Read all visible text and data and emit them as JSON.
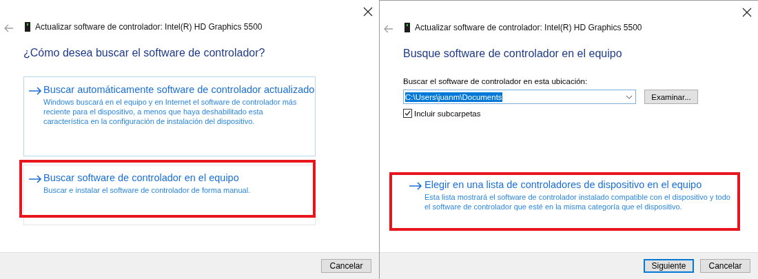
{
  "dialogs": [
    {
      "title": "Actualizar software de controlador: Intel(R) HD Graphics 5500",
      "heading": "¿Cómo desea buscar el software de controlador?",
      "options": [
        {
          "kind": "focused",
          "highlighted": false,
          "title": "Buscar automáticamente software de controlador actualizado",
          "description": "Windows buscará en el equipo y en Internet el software de controlador más reciente para el dispositivo, a menos que haya deshabilitado esta característica en la configuración de instalación del dispositivo."
        },
        {
          "kind": "plain",
          "highlighted": true,
          "title": "Buscar software de controlador en el equipo",
          "description": "Buscar e instalar el software de controlador de forma manual."
        }
      ],
      "buttons": [
        {
          "label": "Cancelar",
          "default": false
        }
      ]
    },
    {
      "title": "Actualizar software de controlador: Intel(R) HD Graphics 5500",
      "heading": "Busque software de controlador en el equipo",
      "location": {
        "label": "Buscar el software de controlador en esta ubicación:",
        "value": "C:\\Users\\juanm\\Documents",
        "selected": true,
        "browse": "Examinar...",
        "checkbox": {
          "label": "Incluir subcarpetas",
          "checked": true
        }
      },
      "options": [
        {
          "kind": "bare",
          "highlighted": true,
          "title": "Elegir en una lista de controladores de dispositivo en el equipo",
          "description": "Esta lista mostrará el software de controlador instalado compatible con el dispositivo y todo el software de controlador que esté en la misma categoría que el dispositivo."
        }
      ],
      "buttons": [
        {
          "label": "Siguiente",
          "default": true
        },
        {
          "label": "Cancelar",
          "default": false
        }
      ]
    }
  ]
}
